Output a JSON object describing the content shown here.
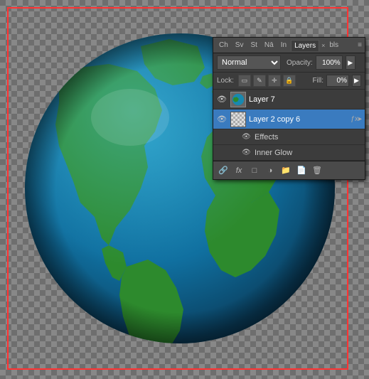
{
  "panel": {
    "tabs": [
      {
        "label": "Ch",
        "active": false
      },
      {
        "label": "Sv",
        "active": false
      },
      {
        "label": "St",
        "active": false
      },
      {
        "label": "Nā",
        "active": false
      },
      {
        "label": "In",
        "active": false
      },
      {
        "label": "Layers",
        "active": true
      },
      {
        "label": "×",
        "isClose": true
      },
      {
        "label": "bls",
        "active": false
      }
    ],
    "menu_icon": "≡",
    "blend_mode": "Normal",
    "opacity_label": "Opacity:",
    "opacity_value": "100%",
    "lock_label": "Lock:",
    "lock_icons": [
      "▭",
      "✎",
      "⌫",
      "🔒"
    ],
    "fill_label": "Fill:",
    "fill_value": "0%",
    "layers": [
      {
        "name": "Layer 7",
        "visible": true,
        "selected": false,
        "has_effects": false,
        "thumb_type": "normal"
      },
      {
        "name": "Layer 2 copy 6",
        "visible": true,
        "selected": true,
        "has_effects": true,
        "thumb_type": "checker"
      }
    ],
    "effects": [
      {
        "name": "Effects"
      },
      {
        "name": "Inner Glow"
      }
    ],
    "toolbar_icons": [
      "🔗",
      "fx",
      "□",
      "◎",
      "□",
      "⊞",
      "🗑"
    ]
  },
  "canvas": {
    "border_color": "#ff3333"
  }
}
